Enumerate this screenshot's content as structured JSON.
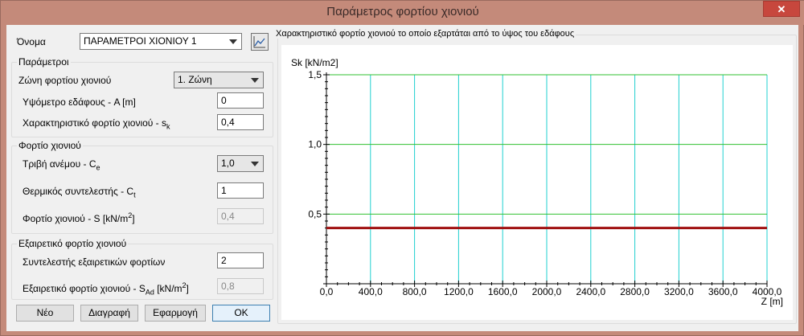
{
  "window": {
    "title": "Παράμετρος φορτίου χιονιού",
    "close_glyph": "✕"
  },
  "name_row": {
    "label": "Όνομα",
    "value": "ΠΑΡΑΜΕΤΡΟΙ ΧΙΟΝΙΟΥ 1",
    "chart_button_icon": "chart-icon"
  },
  "parameters": {
    "title": "Παράμετροι",
    "zone_label": "Ζώνη φορτίου χιονιού",
    "zone_value": "1. Ζώνη",
    "altitude_label": "Υψόμετρο εδάφους - A [m]",
    "altitude_value": "0",
    "char_load_label": "Χαρακτηριστικό φορτίο χιονιού - s",
    "char_load_sub": "k",
    "char_load_value": "0,4"
  },
  "snow_load": {
    "title": "Φορτίο χιονιού",
    "exposure_label": "Τριβή ανέμου - C",
    "exposure_sub": "e",
    "exposure_value": "1,0",
    "thermal_label": "Θερμικός συντελεστής - C",
    "thermal_sub": "t",
    "thermal_value": "1",
    "snow_label_pre": "Φορτίο χιονιού - S [kN/m",
    "snow_label_sup": "2",
    "snow_label_post": "]",
    "snow_value": "0,4"
  },
  "exceptional": {
    "title": "Εξαιρετικό φορτίο χιονιού",
    "factor_label": "Συντελεστής εξαιρετικών φορτίων",
    "factor_value": "2",
    "load_label_pre": "Εξαιρετικό φορτίο χιονιού - S",
    "load_label_sub": "Ad",
    "load_label_mid": " [kN/m",
    "load_label_sup": "2",
    "load_label_post": "]",
    "load_value": "0,8"
  },
  "buttons": {
    "new": "Νέο",
    "delete": "Διαγραφή",
    "apply": "Εφαρμογή",
    "ok": "OK"
  },
  "chart_group": {
    "title": "Χαρακτηριστικό φορτίο χιονιού το οποίο εξαρτάται από το ύψος του εδάφους"
  },
  "chart_data": {
    "type": "line",
    "ylabel": "Sk [kN/m2]",
    "xlabel": "Z [m]",
    "xlim": [
      0,
      4000
    ],
    "ylim": [
      0,
      1.5
    ],
    "x_ticks": [
      "0,0",
      "400,0",
      "800,0",
      "1200,0",
      "1600,0",
      "2000,0",
      "2400,0",
      "2800,0",
      "3200,0",
      "3600,0",
      "4000,0"
    ],
    "x_tick_values": [
      0,
      400,
      800,
      1200,
      1600,
      2000,
      2400,
      2800,
      3200,
      3600,
      4000
    ],
    "y_ticks": [
      "0,5",
      "1,0",
      "1,5"
    ],
    "y_tick_values": [
      0.5,
      1.0,
      1.5
    ],
    "grid": true,
    "colors": {
      "series": "#a01010",
      "vgrid": "#20d0d0",
      "hgrid": "#30c030"
    },
    "series": [
      {
        "x": [
          0,
          4000
        ],
        "y": [
          0.4,
          0.4
        ]
      }
    ]
  }
}
